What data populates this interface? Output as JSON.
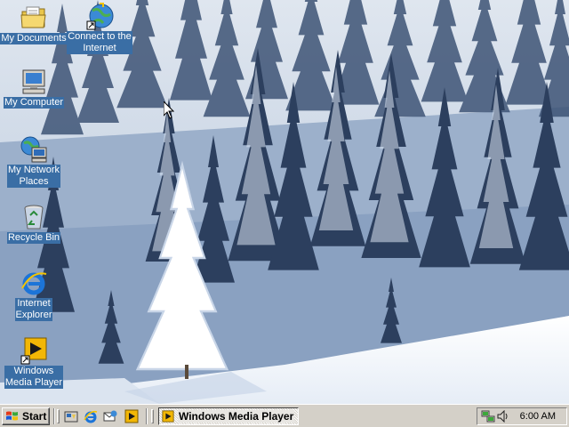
{
  "desktop": {
    "icons": [
      {
        "label": "My Documents",
        "icon": "folder-documents-icon"
      },
      {
        "label": "Connect to the Internet",
        "label_line1": "Connect to the",
        "label_line2": "Internet",
        "icon": "connect-internet-icon"
      },
      {
        "label": "My Computer",
        "icon": "computer-icon"
      },
      {
        "label": "My Network Places",
        "label_line1": "My Network",
        "label_line2": "Places",
        "icon": "network-places-icon"
      },
      {
        "label": "Recycle Bin",
        "icon": "recycle-bin-icon"
      },
      {
        "label": "Internet Explorer",
        "label_line1": "Internet",
        "label_line2": "Explorer",
        "icon": "internet-explorer-icon"
      },
      {
        "label": "Windows Media Player",
        "label_line1": "Windows",
        "label_line2": "Media Player",
        "icon": "media-player-icon"
      }
    ],
    "selection_color": "#3a6ea5"
  },
  "taskbar": {
    "start_label": "Start",
    "quick_launch": [
      "show-desktop-icon",
      "internet-explorer-icon",
      "outlook-express-icon",
      "media-player-icon"
    ],
    "tasks": [
      {
        "label": "Windows Media Player",
        "icon": "media-player-icon",
        "active": true
      }
    ],
    "tray": {
      "icons": [
        "network-connection-icon",
        "volume-icon"
      ],
      "clock": "6:00 AM"
    },
    "face_color": "#d4d0c8"
  }
}
